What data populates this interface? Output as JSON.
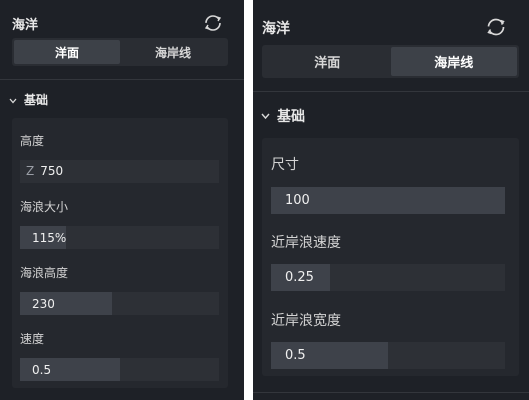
{
  "left": {
    "title": "海洋",
    "tabs": [
      {
        "label": "洋面",
        "active": true
      },
      {
        "label": "海岸线",
        "active": false
      }
    ],
    "section": "基础",
    "fields": [
      {
        "label": "高度",
        "prefix": "Z",
        "value": "750"
      },
      {
        "label": "海浪大小",
        "value": "115%",
        "level": 0.23
      },
      {
        "label": "海浪高度",
        "value": "230",
        "level": 0.46
      },
      {
        "label": "速度",
        "value": "0.5",
        "level": 0.5
      }
    ]
  },
  "right": {
    "title": "海洋",
    "tabs": [
      {
        "label": "洋面",
        "active": false
      },
      {
        "label": "海岸线",
        "active": true
      }
    ],
    "section": "基础",
    "fields": [
      {
        "label": "尺寸",
        "value": "100",
        "level": 1.0
      },
      {
        "label": "近岸浪速度",
        "value": "0.25",
        "level": 0.25
      },
      {
        "label": "近岸浪宽度",
        "value": "0.5",
        "level": 0.5
      }
    ]
  },
  "colors": {
    "panel_bg": "#1e2127",
    "card_bg": "#25282e",
    "input_bg": "#2d3036",
    "slider_fill": "#3e424a",
    "active_tab": "#3d4148"
  },
  "icons": {
    "refresh": "refresh-icon",
    "collapse": "chevron-down-icon"
  }
}
